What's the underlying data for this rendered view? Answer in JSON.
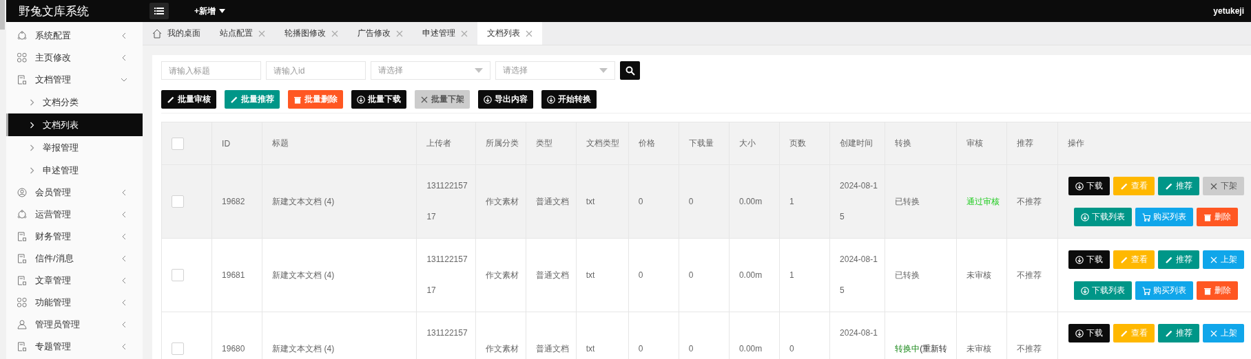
{
  "app": {
    "logo": "野兔文库系统",
    "add_menu": "+新增",
    "user": "yetukeji"
  },
  "sidebar": {
    "items": [
      {
        "label": "系统配置",
        "kind": "cog",
        "expanded": false
      },
      {
        "label": "主页修改",
        "kind": "grid",
        "expanded": false
      },
      {
        "label": "文档管理",
        "kind": "doc",
        "expanded": true,
        "children": [
          {
            "label": "文档分类",
            "selected": false
          },
          {
            "label": "文档列表",
            "selected": true
          },
          {
            "label": "举报管理",
            "selected": false
          },
          {
            "label": "申述管理",
            "selected": false
          }
        ]
      },
      {
        "label": "会员管理",
        "kind": "user",
        "expanded": false
      },
      {
        "label": "运营管理",
        "kind": "cog",
        "expanded": false
      },
      {
        "label": "财务管理",
        "kind": "doc",
        "expanded": false
      },
      {
        "label": "信件/消息",
        "kind": "doc",
        "expanded": false
      },
      {
        "label": "文章管理",
        "kind": "doc",
        "expanded": false
      },
      {
        "label": "功能管理",
        "kind": "grid",
        "expanded": false
      },
      {
        "label": "管理员管理",
        "kind": "admin",
        "expanded": false
      },
      {
        "label": "专题管理",
        "kind": "doc",
        "expanded": false
      }
    ]
  },
  "tabs": [
    {
      "label": "我的桌面",
      "kind": "home",
      "selected": false
    },
    {
      "label": "站点配置",
      "kind": "closable",
      "selected": false
    },
    {
      "label": "轮播图修改",
      "kind": "closable",
      "selected": false
    },
    {
      "label": "广告修改",
      "kind": "closable",
      "selected": false
    },
    {
      "label": "申述管理",
      "kind": "closable",
      "selected": false
    },
    {
      "label": "文档列表",
      "kind": "closable",
      "selected": true
    }
  ],
  "filters": [
    {
      "kind": "input",
      "placeholder": "请输入标题"
    },
    {
      "kind": "input",
      "placeholder": "请输入id"
    },
    {
      "kind": "select",
      "placeholder": "请选择"
    },
    {
      "kind": "select",
      "placeholder": "请选择"
    }
  ],
  "toolbar": [
    {
      "label": "批量审核",
      "kind": "pencil",
      "color": "#0c0c0c",
      "disabled": false
    },
    {
      "label": "批量推荐",
      "kind": "pencil",
      "color": "#009688",
      "disabled": false
    },
    {
      "label": "批量删除",
      "kind": "trash",
      "color": "#ff5722",
      "disabled": false
    },
    {
      "label": "批量下载",
      "kind": "download",
      "color": "#0c0c0c",
      "disabled": false
    },
    {
      "label": "批量下架",
      "kind": "x",
      "color": "#cccccc",
      "disabled": true
    },
    {
      "label": "导出内容",
      "kind": "download",
      "color": "#0c0c0c",
      "disabled": false
    },
    {
      "label": "开始转换",
      "kind": "download",
      "color": "#0c0c0c",
      "disabled": false
    }
  ],
  "table": {
    "header_checked": false,
    "columns": [
      "ID",
      "标题",
      "上传者",
      "所属分类",
      "类型",
      "文档类型",
      "价格",
      "下载量",
      "大小",
      "页数",
      "创建时间",
      "转换",
      "审核",
      "推荐",
      "操作"
    ],
    "rows": [
      {
        "checked": false,
        "hovered": true,
        "id": "19682",
        "title": "新建文本文档 (4)",
        "uploader": "13112215717",
        "category": "作文素材",
        "type": "普通文档",
        "file_type": "txt",
        "price": "0",
        "downloads": "0",
        "size": "0.00m",
        "pages": "1",
        "created": "2024-08-15",
        "convert": {
          "status": "已转换",
          "kind": "done"
        },
        "audit": {
          "status": "通过审核",
          "kind": "approved"
        },
        "recommend": "不推荐",
        "actions": [
          {
            "label": "下载",
            "kind": "download",
            "color": "#0c0c0c",
            "disabled": false
          },
          {
            "label": "查看",
            "kind": "pencil",
            "color": "#ffb800",
            "disabled": false
          },
          {
            "label": "推荐",
            "kind": "pencil",
            "color": "#009688",
            "disabled": false
          },
          {
            "label": "下架",
            "kind": "x",
            "color": "#cccccc",
            "disabled": true
          },
          {
            "label": "下载列表",
            "kind": "download",
            "color": "#009688",
            "disabled": false
          },
          {
            "label": "购买列表",
            "kind": "cart",
            "color": "#10a6ea",
            "disabled": false
          },
          {
            "label": "删除",
            "kind": "trash",
            "color": "#ff5722",
            "disabled": false
          }
        ]
      },
      {
        "checked": false,
        "hovered": false,
        "id": "19681",
        "title": "新建文本文档 (4)",
        "uploader": "13112215717",
        "category": "作文素材",
        "type": "普通文档",
        "file_type": "txt",
        "price": "0",
        "downloads": "0",
        "size": "0.00m",
        "pages": "1",
        "created": "2024-08-15",
        "convert": {
          "status": "已转换",
          "kind": "done"
        },
        "audit": {
          "status": "未审核",
          "kind": "pending"
        },
        "recommend": "不推荐",
        "actions": [
          {
            "label": "下载",
            "kind": "download",
            "color": "#0c0c0c",
            "disabled": false
          },
          {
            "label": "查看",
            "kind": "pencil",
            "color": "#ffb800",
            "disabled": false
          },
          {
            "label": "推荐",
            "kind": "pencil",
            "color": "#009688",
            "disabled": false
          },
          {
            "label": "上架",
            "kind": "x",
            "color": "#10a6ea",
            "disabled": false
          },
          {
            "label": "下载列表",
            "kind": "download",
            "color": "#009688",
            "disabled": false
          },
          {
            "label": "购买列表",
            "kind": "cart",
            "color": "#10a6ea",
            "disabled": false
          },
          {
            "label": "删除",
            "kind": "trash",
            "color": "#ff5722",
            "disabled": false
          }
        ]
      },
      {
        "checked": false,
        "hovered": false,
        "id": "19680",
        "title": "新建文本文档 (4)",
        "uploader": "131122157",
        "category": "作文素材",
        "type": "普通文档",
        "file_type": "txt",
        "price": "0",
        "downloads": "0",
        "size": "0.00m",
        "pages": "0",
        "created": "2024-08-1",
        "convert": {
          "status": "转换中",
          "kind": "converting",
          "action": "(重新转"
        },
        "audit": {
          "status": "未审核",
          "kind": "pending"
        },
        "recommend": "不推荐",
        "actions": [
          {
            "label": "下载",
            "kind": "download",
            "color": "#0c0c0c",
            "disabled": false
          },
          {
            "label": "查看",
            "kind": "pencil",
            "color": "#ffb800",
            "disabled": false
          },
          {
            "label": "推荐",
            "kind": "pencil",
            "color": "#009688",
            "disabled": false
          },
          {
            "label": "上架",
            "kind": "x",
            "color": "#10a6ea",
            "disabled": false
          }
        ]
      }
    ]
  }
}
